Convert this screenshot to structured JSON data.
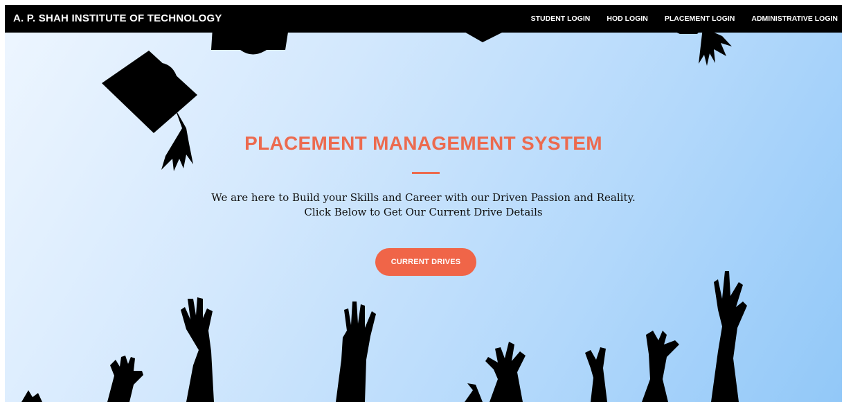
{
  "navbar": {
    "brand": "A. P. SHAH INSTITUTE OF TECHNOLOGY",
    "links": [
      "STUDENT LOGIN",
      "HOD LOGIN",
      "PLACEMENT LOGIN",
      "ADMINISTRATIVE LOGIN"
    ]
  },
  "hero": {
    "title": "PLACEMENT MANAGEMENT SYSTEM",
    "line1": "We are here to Build your Skills and Career with our Driven Passion and Reality.",
    "line2": "Click Below to Get Our Current Drive Details",
    "button_label": "CURRENT DRIVES"
  },
  "colors": {
    "navbar": "#000000",
    "accent": "#ec6a4f",
    "button": "#f06548"
  },
  "icons": [
    "graduation-cap-icon",
    "raised-hands-silhouette"
  ]
}
